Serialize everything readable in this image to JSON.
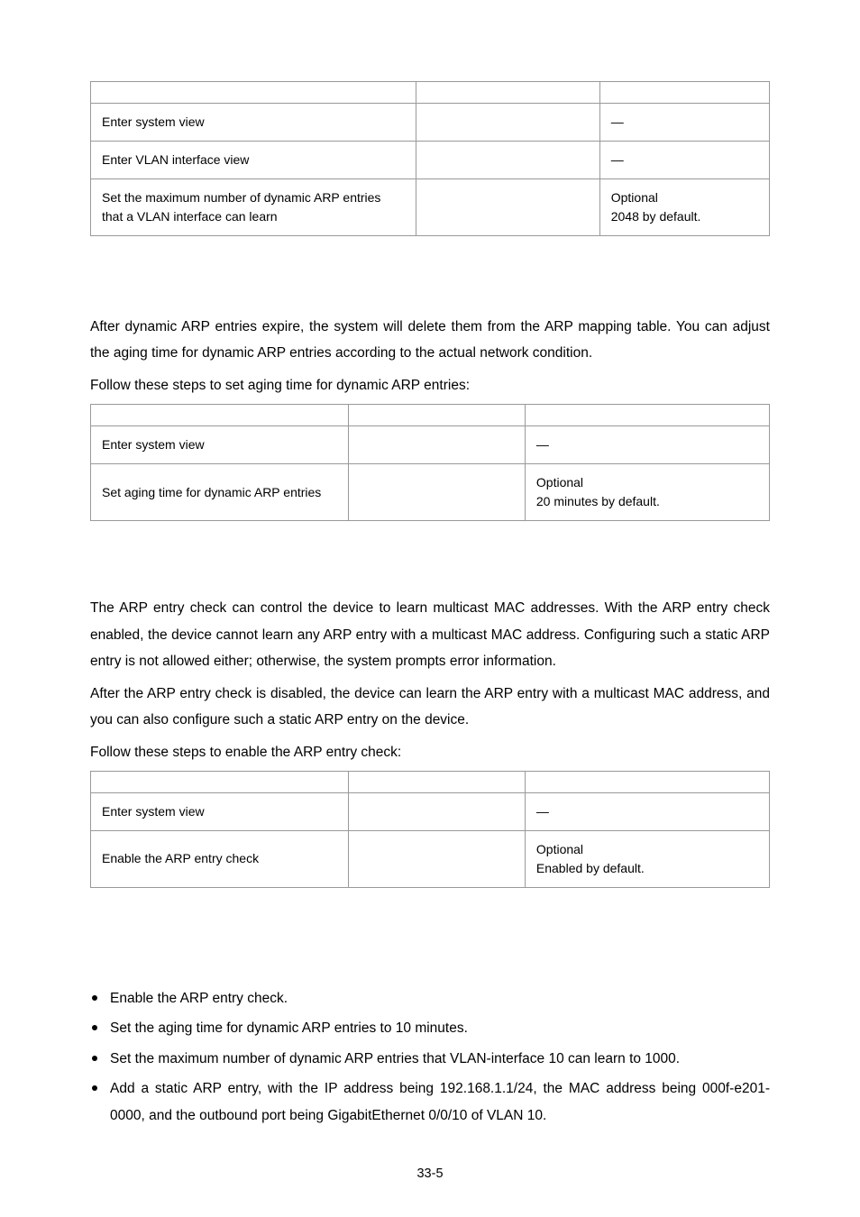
{
  "dash": "—",
  "table1": {
    "r1": {
      "step": "Enter system view"
    },
    "r2": {
      "step": "Enter VLAN interface view"
    },
    "r3": {
      "step": "Set the maximum number of dynamic ARP entries that a VLAN interface can learn",
      "rem1": "Optional",
      "rem2": "2048 by default."
    }
  },
  "section_aging": {
    "p1": "After dynamic ARP entries expire, the system will delete them from the ARP mapping table. You can adjust the aging time for dynamic ARP entries according to the actual network condition.",
    "p2": "Follow these steps to set aging time for dynamic ARP entries:"
  },
  "table2": {
    "r1": {
      "step": "Enter system view"
    },
    "r2": {
      "step": "Set aging time for dynamic ARP entries",
      "rem1": "Optional",
      "rem2": "20 minutes by default."
    }
  },
  "section_check": {
    "p1": "The ARP entry check can control the device to learn multicast MAC addresses. With the ARP entry check enabled, the device cannot learn any ARP entry with a multicast MAC address. Configuring such a static ARP entry is not allowed either; otherwise, the system prompts error information.",
    "p2": "After the ARP entry check is disabled, the device can learn the ARP entry with a multicast MAC address, and you can also configure such a static ARP entry on the device.",
    "p3": "Follow these steps to enable the ARP entry check:"
  },
  "table3": {
    "r1": {
      "step": "Enter system view"
    },
    "r2": {
      "step": "Enable the ARP entry check",
      "rem1": "Optional",
      "rem2": "Enabled by default."
    }
  },
  "bullets": {
    "b1": "Enable the ARP entry check.",
    "b2": "Set the aging time for dynamic ARP entries to 10 minutes.",
    "b3": "Set the maximum number of dynamic ARP entries that VLAN-interface 10 can learn to 1000.",
    "b4": "Add a static ARP entry, with the IP address being 192.168.1.1/24, the MAC address being 000f-e201-0000, and the outbound port being GigabitEthernet 0/0/10 of VLAN 10."
  },
  "page_number": "33-5"
}
